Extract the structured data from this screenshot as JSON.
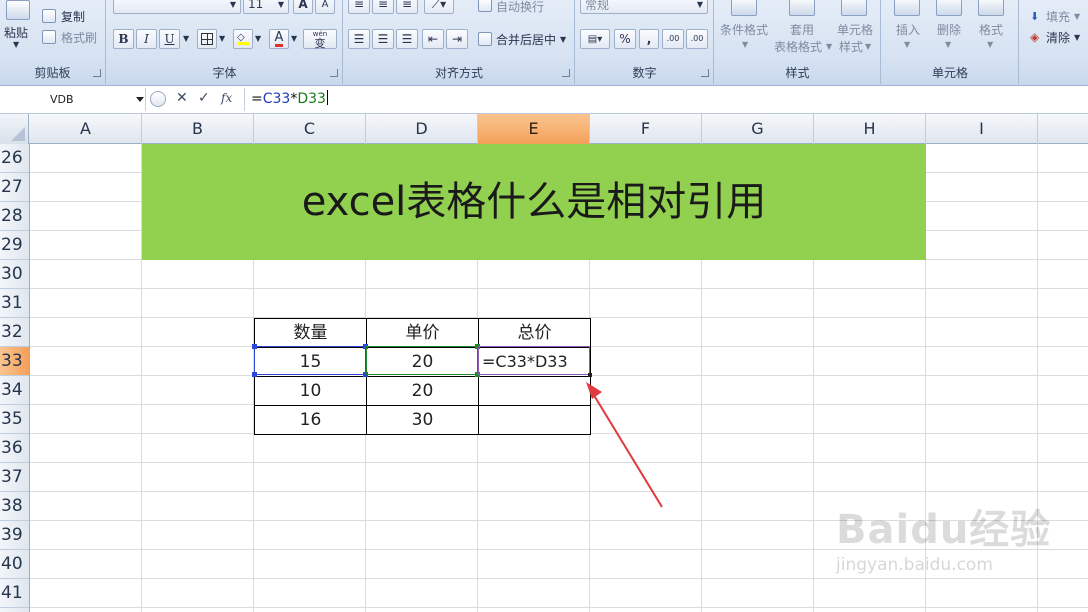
{
  "ribbon": {
    "clipboard": {
      "paste": "粘贴",
      "copy": "复制",
      "format_painter": "格式刷",
      "label": "剪贴板"
    },
    "font": {
      "size": "11",
      "bold": "B",
      "italic": "I",
      "underline": "U",
      "grow_font": "A",
      "shrink_font": "A",
      "phonetic": "wén",
      "phonetic_char": "变",
      "label": "字体"
    },
    "alignment": {
      "wrap_text": "自动换行",
      "merge_center": "合并后居中",
      "label": "对齐方式"
    },
    "number": {
      "format": "常规",
      "percent": "%",
      "comma": ",",
      "inc_decimal": ".00",
      "dec_decimal": ".00",
      "label": "数字"
    },
    "styles": {
      "conditional_format": "条件格式",
      "format_table_1": "套用",
      "format_table_2": "表格格式",
      "cell_styles_1": "单元格",
      "cell_styles_2": "样式",
      "label": "样式"
    },
    "cells": {
      "insert": "插入",
      "delete": "删除",
      "format": "格式",
      "label": "单元格"
    },
    "editing": {
      "fill": "填充",
      "clear": "清除"
    }
  },
  "formula_bar": {
    "name_box": "VDB",
    "cancel": "✕",
    "enter": "✓",
    "fx": "fx",
    "formula_prefix": "=",
    "formula_ref1": "C33",
    "formula_op": "*",
    "formula_ref2": "D33"
  },
  "columns": [
    "A",
    "B",
    "C",
    "D",
    "E",
    "F",
    "G",
    "H",
    "I"
  ],
  "rows": [
    "26",
    "27",
    "28",
    "29",
    "30",
    "31",
    "32",
    "33",
    "34",
    "35",
    "36",
    "37",
    "38",
    "39",
    "40",
    "41"
  ],
  "selected_column": "E",
  "selected_row": "33",
  "banner_title": "excel表格什么是相对引用",
  "table": {
    "headers": [
      "数量",
      "单价",
      "总价"
    ],
    "rows": [
      [
        "15",
        "20",
        "=C33*D33"
      ],
      [
        "10",
        "20",
        ""
      ],
      [
        "16",
        "30",
        ""
      ]
    ]
  },
  "colors": {
    "banner": "#92d050",
    "ref1": "#2b48d8",
    "ref2": "#1f8a2c",
    "arrow": "#e0393e",
    "selected_header": "#f4a05a"
  },
  "watermark": {
    "logo": "Baidu经验",
    "url": "jingyan.baidu.com"
  }
}
